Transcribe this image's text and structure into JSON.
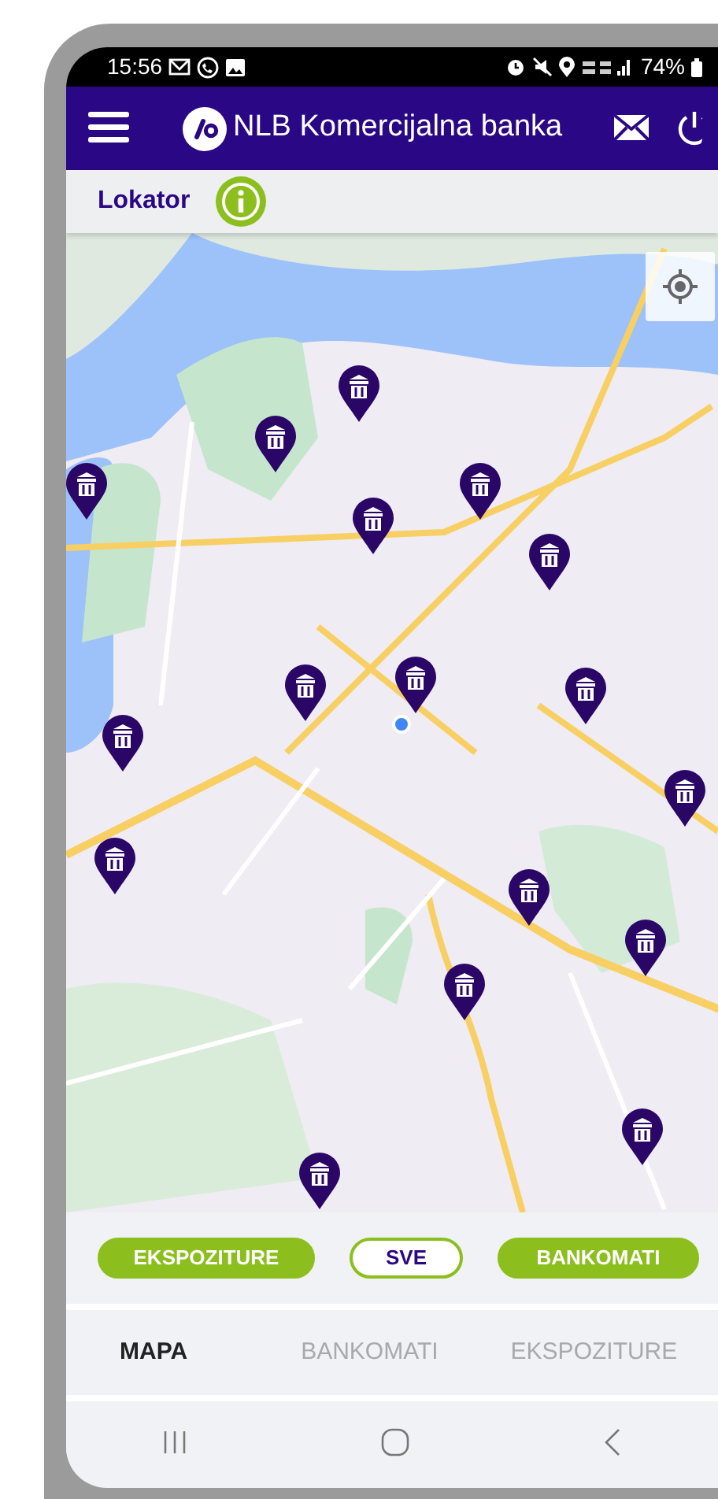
{
  "status_bar": {
    "time": "15:56",
    "battery": "74%"
  },
  "header": {
    "title": "NLB Komercijalna banka"
  },
  "page": {
    "title": "Lokator"
  },
  "filters": [
    {
      "label": "EKSPOZITURE",
      "selected": false
    },
    {
      "label": "SVE",
      "selected": true
    },
    {
      "label": "BANKOMATI",
      "selected": false
    }
  ],
  "tabs": [
    {
      "label": "MAPA",
      "selected": true
    },
    {
      "label": "BANKOMATI",
      "selected": false
    },
    {
      "label": "EKSPOZITURE",
      "selected": false
    }
  ]
}
